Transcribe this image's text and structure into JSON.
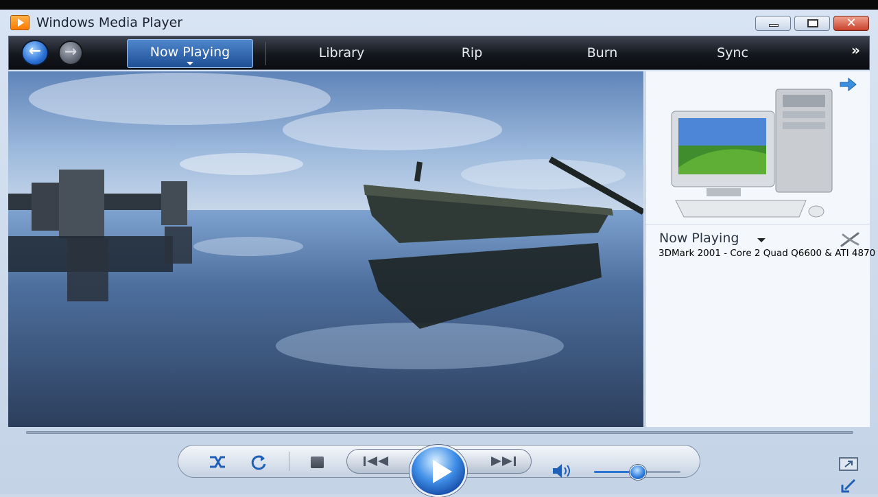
{
  "window": {
    "title": "Windows Media Player",
    "icons": {
      "app": "media-player-icon",
      "minimize": "minimize-icon",
      "maximize": "maximize-icon",
      "close": "close-icon"
    },
    "close_glyph": "✕"
  },
  "nav": {
    "back_glyph": "←",
    "forward_glyph": "→",
    "tabs": [
      {
        "label": "Now Playing",
        "active": true
      },
      {
        "label": "Library"
      },
      {
        "label": "Rip"
      },
      {
        "label": "Burn"
      },
      {
        "label": "Sync"
      }
    ],
    "more_glyph": "»"
  },
  "now_playing": {
    "title": "Now Playing",
    "items": [
      "3DMark 2001 - Core 2 Quad Q6600 & ATI 4870"
    ]
  },
  "playback": {
    "state": "paused",
    "volume": 0.5,
    "seek": 0
  },
  "colors": {
    "accent": "#2a6fd6",
    "nav_bg": "#14171d",
    "pane_bg": "#f4f7fb"
  }
}
